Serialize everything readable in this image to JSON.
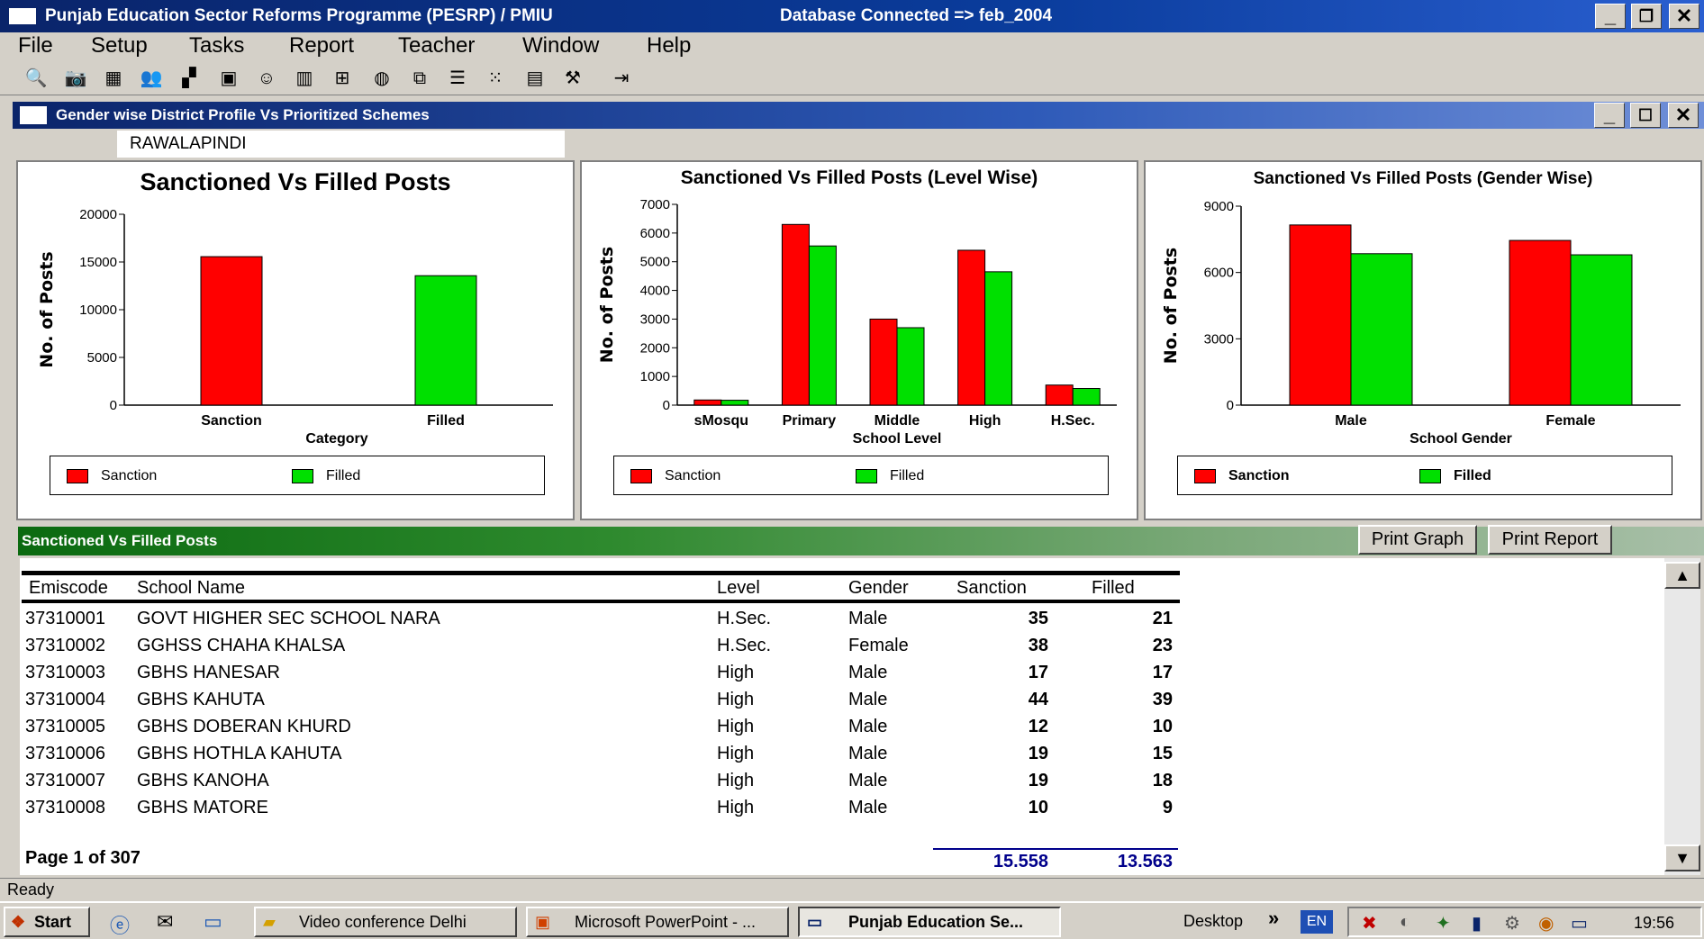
{
  "app": {
    "title": "Punjab Education Sector Reforms Programme (PESRP) / PMIU",
    "db_status": "Database Connected => feb_2004"
  },
  "menu": [
    "File",
    "Setup",
    "Tasks",
    "Report",
    "Teacher",
    "Window",
    "Help"
  ],
  "toolbar_icons": [
    "search-icon",
    "camera-icon",
    "report-icon",
    "people-icon",
    "grid-icon",
    "picture-icon",
    "smiley-icon",
    "bar-chart-icon",
    "tree-icon",
    "bag-icon",
    "copy-icon",
    "list-icon",
    "dots-icon",
    "table-icon",
    "tools-icon",
    "exit-icon"
  ],
  "child_window": {
    "title": "Gender wise District Profile Vs Prioritized Schemes",
    "district": "RAWALAPINDI"
  },
  "colors": {
    "sanction": "#ff0000",
    "filled": "#00e000",
    "title_bar": "#0a246a",
    "grid_bar": "#2e8a2e",
    "totals": "#00008b"
  },
  "chart_data": [
    {
      "type": "bar",
      "title": "Sanctioned Vs Filled Posts",
      "xlabel": "Category",
      "ylabel": "No. of Posts",
      "categories": [
        "Sanction",
        "Filled"
      ],
      "series": [
        {
          "name": "Sanction",
          "values": [
            15558,
            null
          ]
        },
        {
          "name": "Filled",
          "values": [
            null,
            13563
          ]
        }
      ],
      "ylim": [
        0,
        20000
      ],
      "yticks": [
        0,
        5000,
        10000,
        15000,
        20000
      ],
      "legend": "bottom"
    },
    {
      "type": "bar",
      "title": "Sanctioned Vs Filled Posts (Level Wise)",
      "xlabel": "School Level",
      "ylabel": "No. of Posts",
      "categories": [
        "sMosqu",
        "Primary",
        "Middle",
        "High",
        "H.Sec."
      ],
      "series": [
        {
          "name": "Sanction",
          "values": [
            180,
            6300,
            3000,
            5400,
            700
          ]
        },
        {
          "name": "Filled",
          "values": [
            170,
            5550,
            2700,
            4650,
            580
          ]
        }
      ],
      "ylim": [
        0,
        7000
      ],
      "yticks": [
        0,
        1000,
        2000,
        3000,
        4000,
        5000,
        6000,
        7000
      ],
      "legend": "bottom"
    },
    {
      "type": "bar",
      "title": "Sanctioned Vs Filled Posts (Gender Wise)",
      "xlabel": "School Gender",
      "ylabel": "No. of Posts",
      "categories": [
        "Male",
        "Female"
      ],
      "series": [
        {
          "name": "Sanction",
          "values": [
            8150,
            7450
          ]
        },
        {
          "name": "Filled",
          "values": [
            6850,
            6800
          ]
        }
      ],
      "ylim": [
        0,
        9000
      ],
      "yticks": [
        0,
        3000,
        6000,
        9000
      ],
      "legend": "bottom"
    }
  ],
  "grid": {
    "title": "Sanctioned Vs Filled Posts",
    "print_graph": "Print Graph",
    "print_report": "Print Report",
    "columns": [
      "Emiscode",
      "School Name",
      "Level",
      "Gender",
      "Sanction",
      "Filled"
    ],
    "rows": [
      [
        "37310001",
        "GOVT HIGHER SEC SCHOOL NARA",
        "H.Sec.",
        "Male",
        "35",
        "21"
      ],
      [
        "37310002",
        "GGHSS CHAHA KHALSA",
        "H.Sec.",
        "Female",
        "38",
        "23"
      ],
      [
        "37310003",
        "GBHS HANESAR",
        "High",
        "Male",
        "17",
        "17"
      ],
      [
        "37310004",
        "GBHS KAHUTA",
        "High",
        "Male",
        "44",
        "39"
      ],
      [
        "37310005",
        "GBHS DOBERAN KHURD",
        "High",
        "Male",
        "12",
        "10"
      ],
      [
        "37310006",
        "GBHS HOTHLA KAHUTA",
        "High",
        "Male",
        "19",
        "15"
      ],
      [
        "37310007",
        "GBHS KANOHA",
        "High",
        "Male",
        "19",
        "18"
      ],
      [
        "37310008",
        "GBHS MATORE",
        "High",
        "Male",
        "10",
        "9"
      ]
    ],
    "page_info": "Page 1 of 307",
    "total_sanction": "15.558",
    "total_filled": "13.563"
  },
  "status": "Ready",
  "taskbar": {
    "start": "Start",
    "tasks": [
      "Video conference Delhi",
      "Microsoft PowerPoint - ...",
      "Punjab Education Se..."
    ],
    "desktop": "Desktop",
    "lang": "EN",
    "clock": "19:56"
  }
}
